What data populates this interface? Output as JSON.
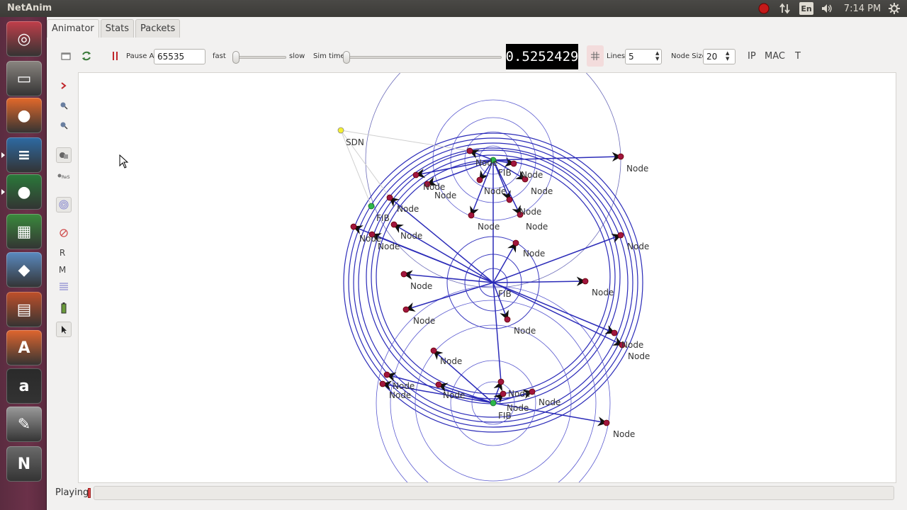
{
  "topbar": {
    "app_title": "NetAnim",
    "lang": "En",
    "time": "7:14 PM",
    "icons": [
      "record-icon",
      "network-icon",
      "keyboard-icon",
      "volume-icon",
      "settings-gear-icon"
    ]
  },
  "launcher": {
    "items": [
      {
        "name": "ubuntu-dash",
        "glyph": "◎",
        "color": "#c13e4a"
      },
      {
        "name": "files",
        "glyph": "▭",
        "color": "#8a8580"
      },
      {
        "name": "firefox",
        "glyph": "●",
        "color": "#e4692a"
      },
      {
        "name": "writer",
        "glyph": "≡",
        "color": "#2d6aa3"
      },
      {
        "name": "netanim",
        "glyph": "●",
        "color": "#2a7a3a"
      },
      {
        "name": "calc",
        "glyph": "▦",
        "color": "#3a8a3c"
      },
      {
        "name": "virtualbox",
        "glyph": "◆",
        "color": "#5a8ac0"
      },
      {
        "name": "impress",
        "glyph": "▤",
        "color": "#c0502a"
      },
      {
        "name": "software-center",
        "glyph": "A",
        "color": "#e0662e"
      },
      {
        "name": "amazon",
        "glyph": "a",
        "color": "#2a2a2a"
      },
      {
        "name": "system-settings",
        "glyph": "✎",
        "color": "#9a9a9a"
      },
      {
        "name": "terminal",
        "glyph": "N",
        "color": "#6a6a6a"
      }
    ]
  },
  "tabs": [
    {
      "label": "Animator",
      "active": true
    },
    {
      "label": "Stats",
      "active": false
    },
    {
      "label": "Packets",
      "active": false
    }
  ],
  "toolbar": {
    "pause_at_label": "Pause At",
    "pause_at_value": "65535",
    "fast_label": "fast",
    "slow_label": "slow",
    "sim_time_label": "Sim time",
    "sim_time_value": "0.5252429",
    "lines_label": "Lines",
    "lines_value": "5",
    "node_size_label": "Node Size",
    "node_size_value": "20",
    "ip_label": "IP",
    "mac_label": "MAC",
    "t_label": "T"
  },
  "sidebar": {
    "r_label": "R",
    "m_label": "M"
  },
  "canvas": {
    "node_label": "Node",
    "fib_label": "FIB",
    "sdn_label": "SDN",
    "accent": "#2b2bb8",
    "node_color": "#a0153e"
  },
  "status": {
    "text": "Playing"
  }
}
